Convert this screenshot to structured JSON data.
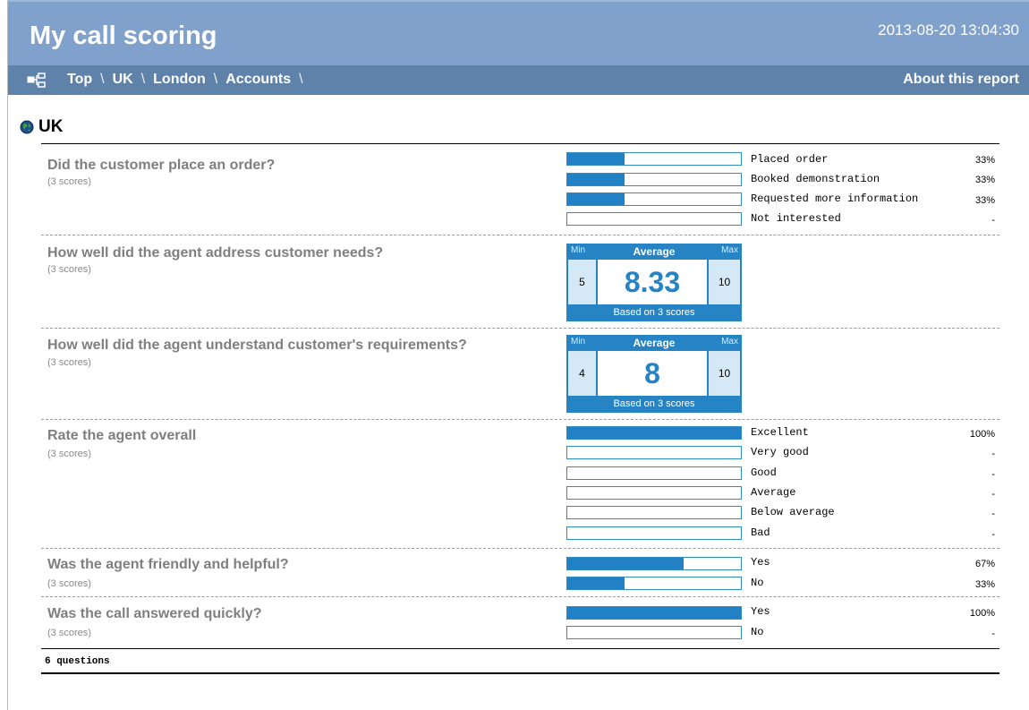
{
  "header": {
    "title": "My call scoring",
    "timestamp": "2013-08-20 13:04:30"
  },
  "nav": {
    "breadcrumb": [
      "Top",
      "UK",
      "London",
      "Accounts"
    ],
    "separator": "\\",
    "about_label": "About this report"
  },
  "section": {
    "title": "UK",
    "icon": "globe-icon"
  },
  "questions": [
    {
      "title": "Did the customer place an order?",
      "scores": "(3 scores)",
      "type": "bars",
      "options": [
        {
          "label": "Placed order",
          "pct_text": "33%",
          "fraction": 0.33
        },
        {
          "label": "Booked demonstration",
          "pct_text": "33%",
          "fraction": 0.33
        },
        {
          "label": "Requested more information",
          "pct_text": "33%",
          "fraction": 0.33
        },
        {
          "label": "Not interested",
          "pct_text": "-",
          "fraction": 0
        }
      ]
    },
    {
      "title": "How well did the agent address customer needs?",
      "scores": "(3 scores)",
      "type": "score",
      "min_label": "Min",
      "avg_label": "Average",
      "max_label": "Max",
      "min": "5",
      "avg": "8.33",
      "max": "10",
      "based_on": "Based on 3 scores"
    },
    {
      "title": "How well did the agent understand customer's requirements?",
      "scores": "(3 scores)",
      "type": "score",
      "min_label": "Min",
      "avg_label": "Average",
      "max_label": "Max",
      "min": "4",
      "avg": "8",
      "max": "10",
      "based_on": "Based on 3 scores"
    },
    {
      "title": "Rate the agent overall",
      "scores": "(3 scores)",
      "type": "bars",
      "options": [
        {
          "label": "Excellent",
          "pct_text": "100%",
          "fraction": 1.0
        },
        {
          "label": "Very good",
          "pct_text": "-",
          "fraction": 0
        },
        {
          "label": "Good",
          "pct_text": "-",
          "fraction": 0
        },
        {
          "label": "Average",
          "pct_text": "-",
          "fraction": 0
        },
        {
          "label": "Below average",
          "pct_text": "-",
          "fraction": 0
        },
        {
          "label": "Bad",
          "pct_text": "-",
          "fraction": 0
        }
      ]
    },
    {
      "title": "Was the agent friendly and helpful?",
      "scores": "(3 scores)",
      "type": "bars",
      "options": [
        {
          "label": "Yes",
          "pct_text": "67%",
          "fraction": 0.67
        },
        {
          "label": "No",
          "pct_text": "33%",
          "fraction": 0.33
        }
      ]
    },
    {
      "title": "Was the call answered quickly?",
      "scores": "(3 scores)",
      "type": "bars",
      "options": [
        {
          "label": "Yes",
          "pct_text": "100%",
          "fraction": 1.0
        },
        {
          "label": "No",
          "pct_text": "-",
          "fraction": 0
        }
      ]
    }
  ],
  "footer": {
    "count_text": "6 questions"
  },
  "colors": {
    "header_bg": "#7fa1cb",
    "nav_bg": "#5f82ab",
    "bar_fill": "#2281c4",
    "score_box": "#2683c4"
  }
}
